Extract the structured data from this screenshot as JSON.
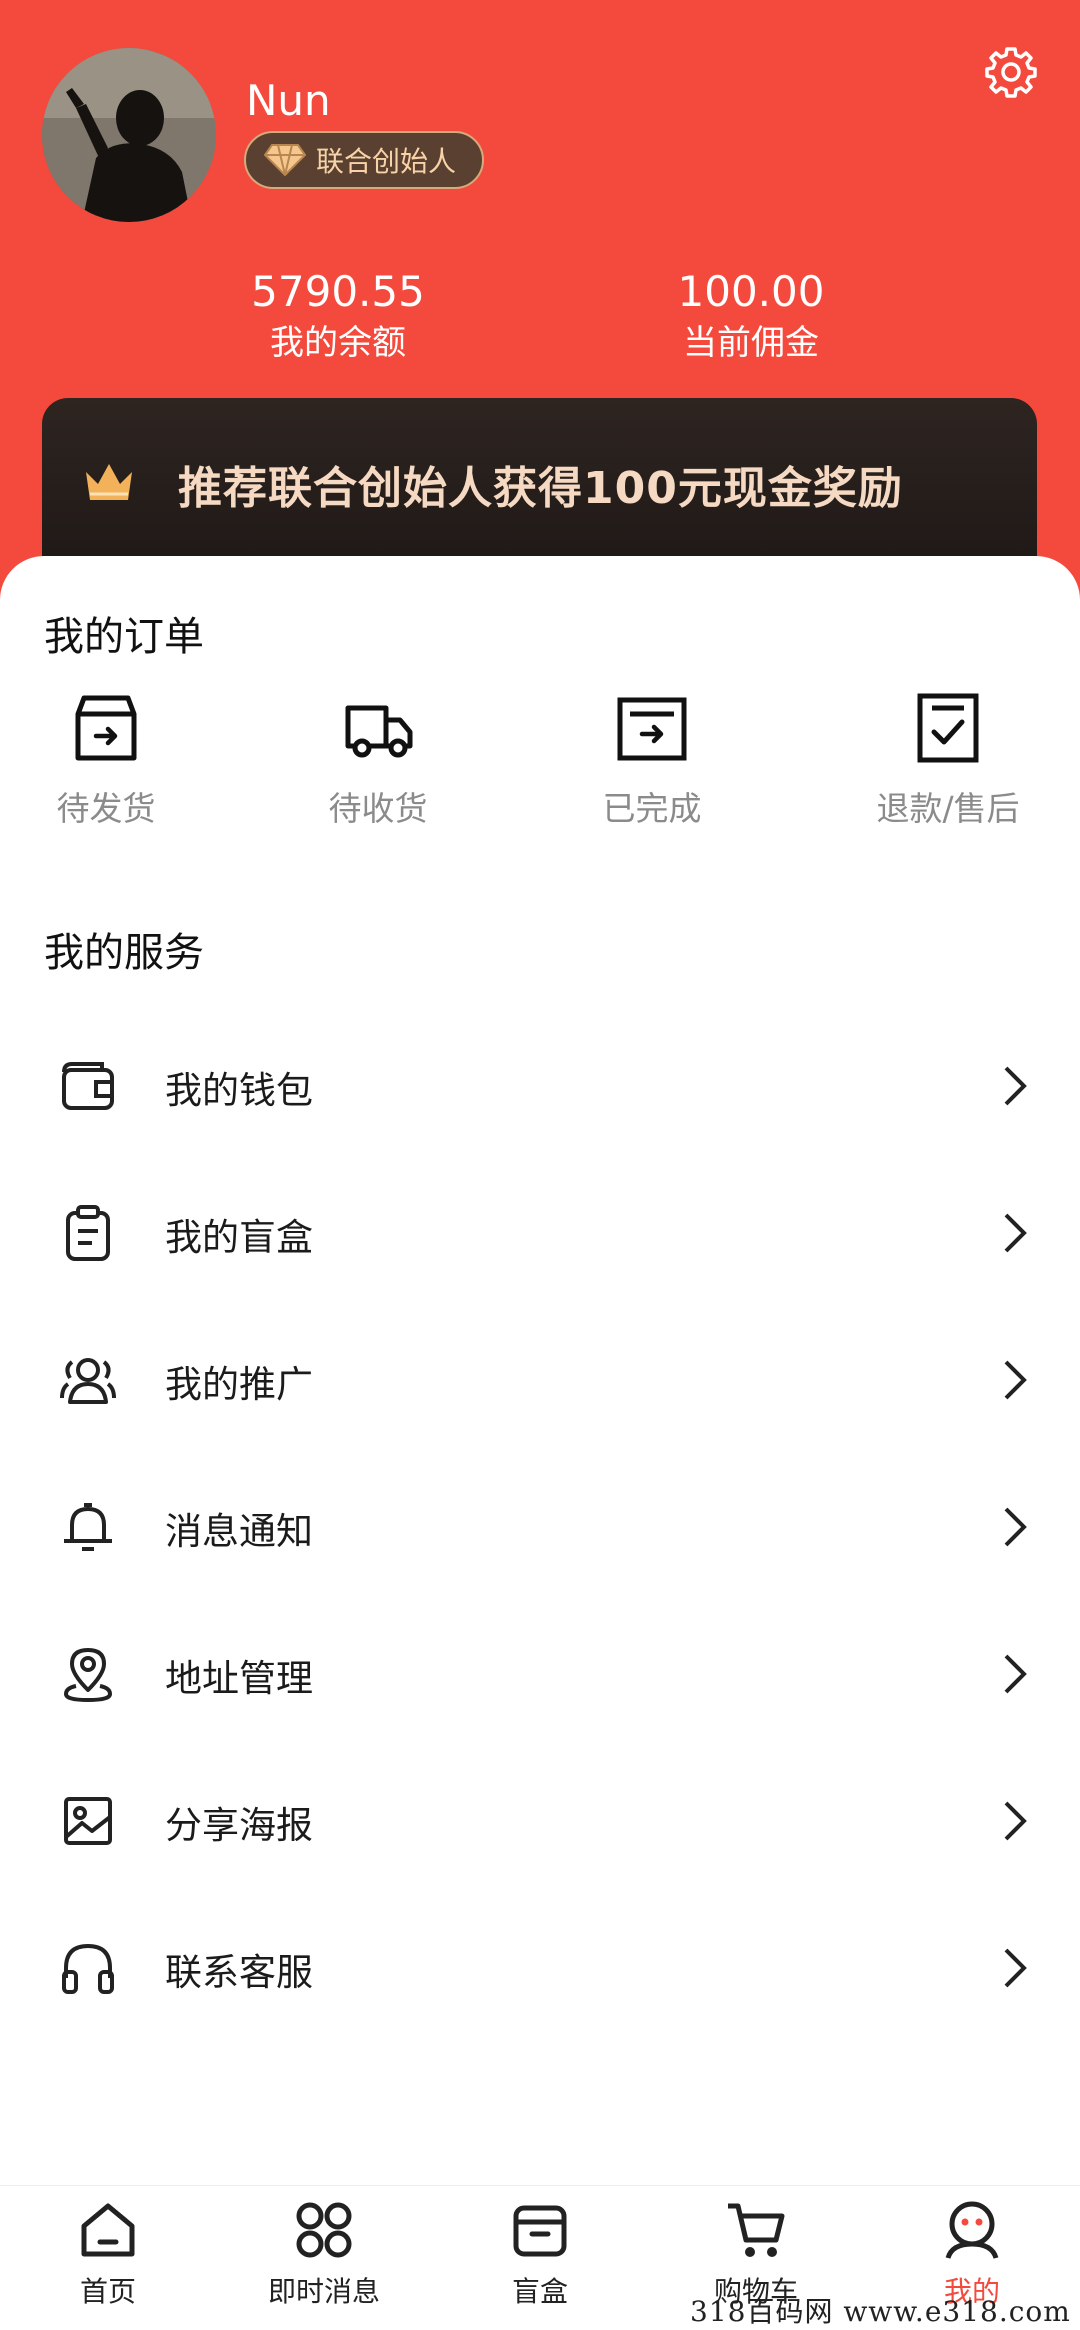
{
  "profile": {
    "username": "Nun",
    "badge": "联合创始人",
    "balance_value": "5790.55",
    "balance_label": "我的余额",
    "commission_value": "100.00",
    "commission_label": "当前佣金"
  },
  "promo": {
    "text": "推荐联合创始人获得100元现金奖励"
  },
  "orders": {
    "title": "我的订单",
    "items": [
      {
        "label": "待发货",
        "icon": "box-arrow-icon"
      },
      {
        "label": "待收货",
        "icon": "truck-icon"
      },
      {
        "label": "已完成",
        "icon": "tray-arrow-icon"
      },
      {
        "label": "退款/售后",
        "icon": "check-doc-icon"
      }
    ]
  },
  "services": {
    "title": "我的服务",
    "items": [
      {
        "label": "我的钱包",
        "icon": "wallet-icon"
      },
      {
        "label": "我的盲盒",
        "icon": "clipboard-icon"
      },
      {
        "label": "我的推广",
        "icon": "users-icon"
      },
      {
        "label": "消息通知",
        "icon": "bell-icon"
      },
      {
        "label": "地址管理",
        "icon": "location-pin-icon"
      },
      {
        "label": "分享海报",
        "icon": "image-icon"
      },
      {
        "label": "联系客服",
        "icon": "headphones-icon"
      }
    ]
  },
  "tabbar": {
    "items": [
      {
        "label": "首页",
        "icon": "home-icon"
      },
      {
        "label": "即时消息",
        "icon": "grid-icon"
      },
      {
        "label": "盲盒",
        "icon": "box-icon"
      },
      {
        "label": "购物车",
        "icon": "cart-icon"
      },
      {
        "label": "我的",
        "icon": "profile-icon",
        "active": true
      }
    ]
  },
  "watermark": "318百码网  www.e318.com",
  "colors": {
    "header": "#f44a3d",
    "active_tab": "#f44a3d",
    "badge_text": "#f7d3a7"
  }
}
